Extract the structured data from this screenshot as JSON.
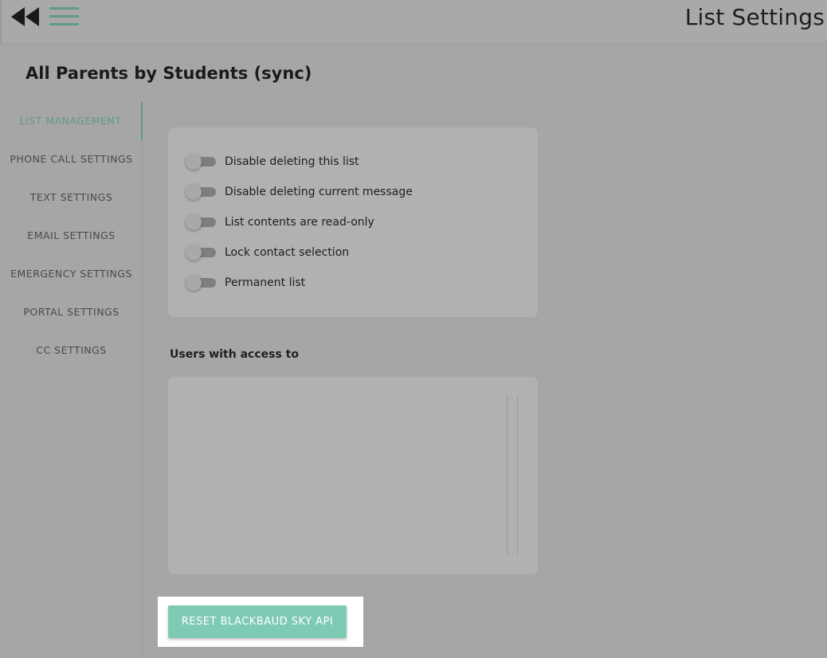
{
  "header": {
    "title": "List Settings",
    "back_icon": "double-chevron-left-icon",
    "menu_icon": "hamburger-menu-icon"
  },
  "list_name": "All Parents by Students (sync)",
  "sidebar": {
    "items": [
      {
        "label": "LIST MANAGEMENT",
        "active": true
      },
      {
        "label": "PHONE CALL SETTINGS",
        "active": false
      },
      {
        "label": "TEXT SETTINGS",
        "active": false
      },
      {
        "label": "EMAIL SETTINGS",
        "active": false
      },
      {
        "label": "EMERGENCY SETTINGS",
        "active": false
      },
      {
        "label": "PORTAL SETTINGS",
        "active": false
      },
      {
        "label": "CC SETTINGS",
        "active": false
      }
    ]
  },
  "toggles": [
    {
      "label": "Disable deleting this list",
      "on": false
    },
    {
      "label": "Disable deleting current message",
      "on": false
    },
    {
      "label": "List contents are read-only",
      "on": false
    },
    {
      "label": "Lock contact selection",
      "on": false
    },
    {
      "label": "Permanent list",
      "on": false
    }
  ],
  "users_section": {
    "label": "Users with access to"
  },
  "reset_button": {
    "label": "RESET BLACKBAUD SKY API"
  },
  "colors": {
    "accent": "#5e9a86",
    "button": "#7ecab5",
    "background": "#a6a6a6",
    "card": "#b1b1b1"
  }
}
